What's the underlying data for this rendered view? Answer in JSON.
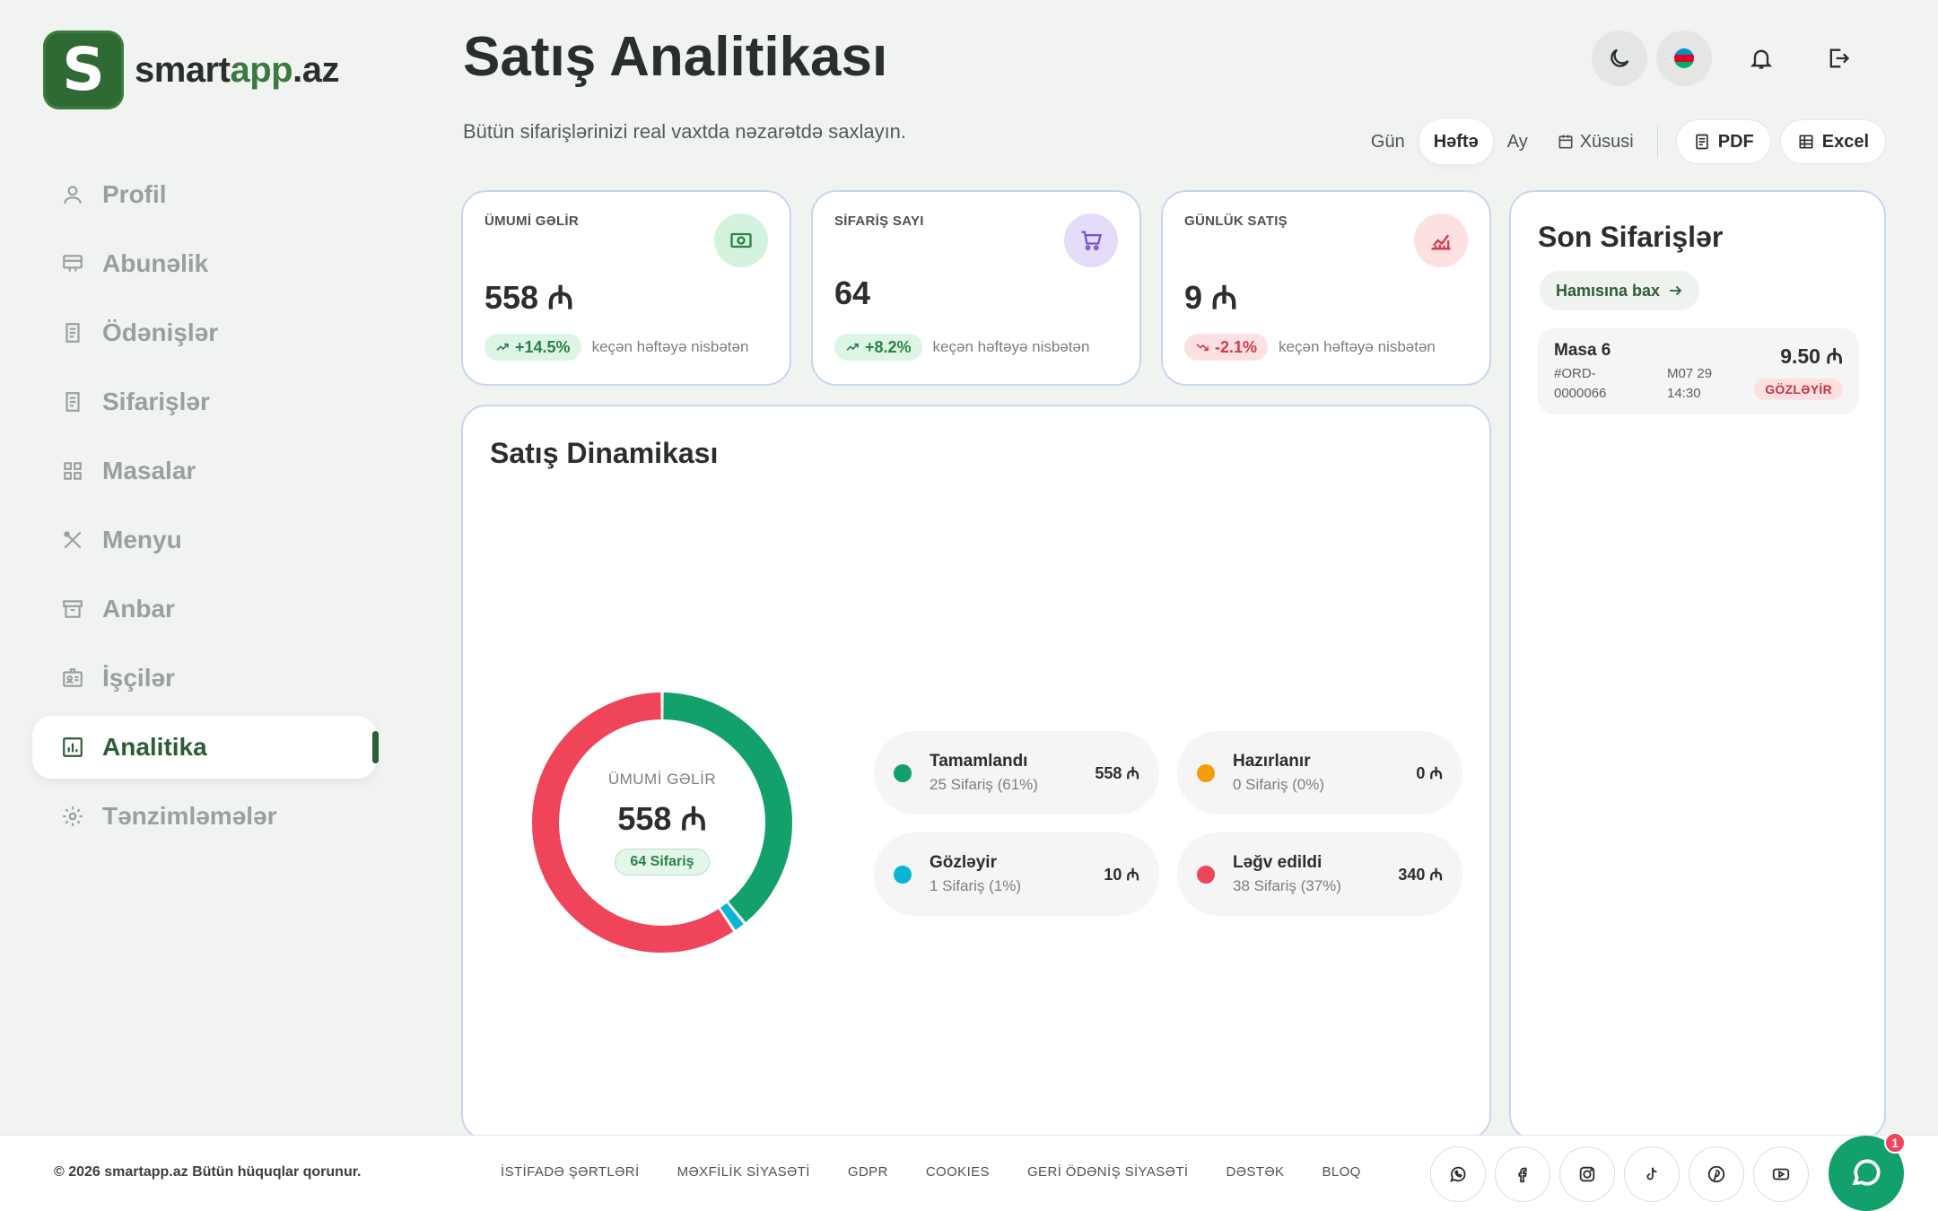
{
  "brand": {
    "logo_letter": "S",
    "name_part1": "smart",
    "name_part2": "app",
    "name_part3": ".az"
  },
  "sidebar": {
    "items": [
      {
        "label": "Profil",
        "icon": "user-icon",
        "active": false
      },
      {
        "label": "Abunəlik",
        "icon": "subscription-icon",
        "active": false
      },
      {
        "label": "Ödənişlər",
        "icon": "receipt-icon",
        "active": false
      },
      {
        "label": "Sifarişlər",
        "icon": "receipt-icon",
        "active": false
      },
      {
        "label": "Masalar",
        "icon": "grid-icon",
        "active": false
      },
      {
        "label": "Menyu",
        "icon": "utensils-icon",
        "active": false
      },
      {
        "label": "Anbar",
        "icon": "archive-icon",
        "active": false
      },
      {
        "label": "İşçilər",
        "icon": "badge-icon",
        "active": false
      },
      {
        "label": "Analitika",
        "icon": "analytics-icon",
        "active": true
      },
      {
        "label": "Tənzimləmələr",
        "icon": "gear-icon",
        "active": false
      }
    ]
  },
  "header": {
    "title": "Satış Analitikası",
    "subtitle": "Bütün sifarişlərinizi real vaxtda nəzarətdə saxlayın."
  },
  "ranges": {
    "day": "Gün",
    "week": "Həftə",
    "month": "Ay",
    "custom": "Xüsusi",
    "active": "Həftə"
  },
  "export": {
    "pdf": "PDF",
    "excel": "Excel"
  },
  "stats": [
    {
      "label": "ÜMUMİ GƏLİR",
      "value": "558 ₼",
      "trend": "+14.5%",
      "direction": "up",
      "compare": "keçən həftəyə nisbətən",
      "icon": "money-icon",
      "color": "#d4f3df"
    },
    {
      "label": "SİFARİŞ SAYI",
      "value": "64",
      "trend": "+8.2%",
      "direction": "up",
      "compare": "keçən həftəyə nisbətən",
      "icon": "cart-icon",
      "color": "#e5dcfa"
    },
    {
      "label": "GÜNLÜK SATIŞ",
      "value": "9 ₼",
      "trend": "-2.1%",
      "direction": "down",
      "compare": "keçən həftəyə nisbətən",
      "icon": "chart-line-icon",
      "color": "#fde0e2"
    }
  ],
  "dynamics": {
    "title": "Satış Dinamikası",
    "center_label": "ÜMUMİ GƏLİR",
    "center_value": "558 ₼",
    "center_badge": "64 Sifariş",
    "legend": [
      {
        "name": "Tamamlandı",
        "detail": "25 Sifariş (61%)",
        "amount": "558 ₼",
        "color": "#12a06b"
      },
      {
        "name": "Hazırlanır",
        "detail": "0 Sifariş (0%)",
        "amount": "0 ₼",
        "color": "#f59e0b"
      },
      {
        "name": "Gözləyir",
        "detail": "1 Sifariş (1%)",
        "amount": "10 ₼",
        "color": "#06b6d4"
      },
      {
        "name": "Ləğv edildi",
        "detail": "38 Sifariş (37%)",
        "amount": "340 ₼",
        "color": "#ef4459"
      }
    ]
  },
  "chart_data": {
    "type": "pie",
    "title": "Satış Dinamikası",
    "categories": [
      "Tamamlandı",
      "Hazırlanır",
      "Gözləyir",
      "Ləğv edildi"
    ],
    "values": [
      25,
      0,
      1,
      38
    ],
    "percent": [
      61,
      0,
      1,
      37
    ],
    "amounts": [
      558,
      0,
      10,
      340
    ],
    "colors": [
      "#12a06b",
      "#f59e0b",
      "#06b6d4",
      "#ef4459"
    ],
    "donut": true
  },
  "recent": {
    "title": "Son Sifarişlər",
    "see_all": "Hamısına bax",
    "orders": [
      {
        "table": "Masa 6",
        "id_line1": "#ORD-",
        "id_line2": "0000066",
        "date_line1": "M07 29",
        "date_line2": "14:30",
        "price": "9.50 ₼",
        "status": "GÖZLƏYİR"
      }
    ]
  },
  "footer": {
    "copyright": "© 2026 smartapp.az Bütün hüquqlar qorunur.",
    "links": [
      "İSTİFADƏ ŞƏRTLƏRİ",
      "MƏXFİLİK SİYASƏTİ",
      "GDPR",
      "COOKIES",
      "GERİ ÖDƏNİŞ SİYASƏTİ",
      "DƏSTƏK",
      "BLOQ"
    ],
    "socials": [
      "whatsapp-icon",
      "facebook-icon",
      "instagram-icon",
      "tiktok-icon",
      "pinterest-icon",
      "youtube-icon"
    ]
  },
  "chat": {
    "badge": "1"
  }
}
